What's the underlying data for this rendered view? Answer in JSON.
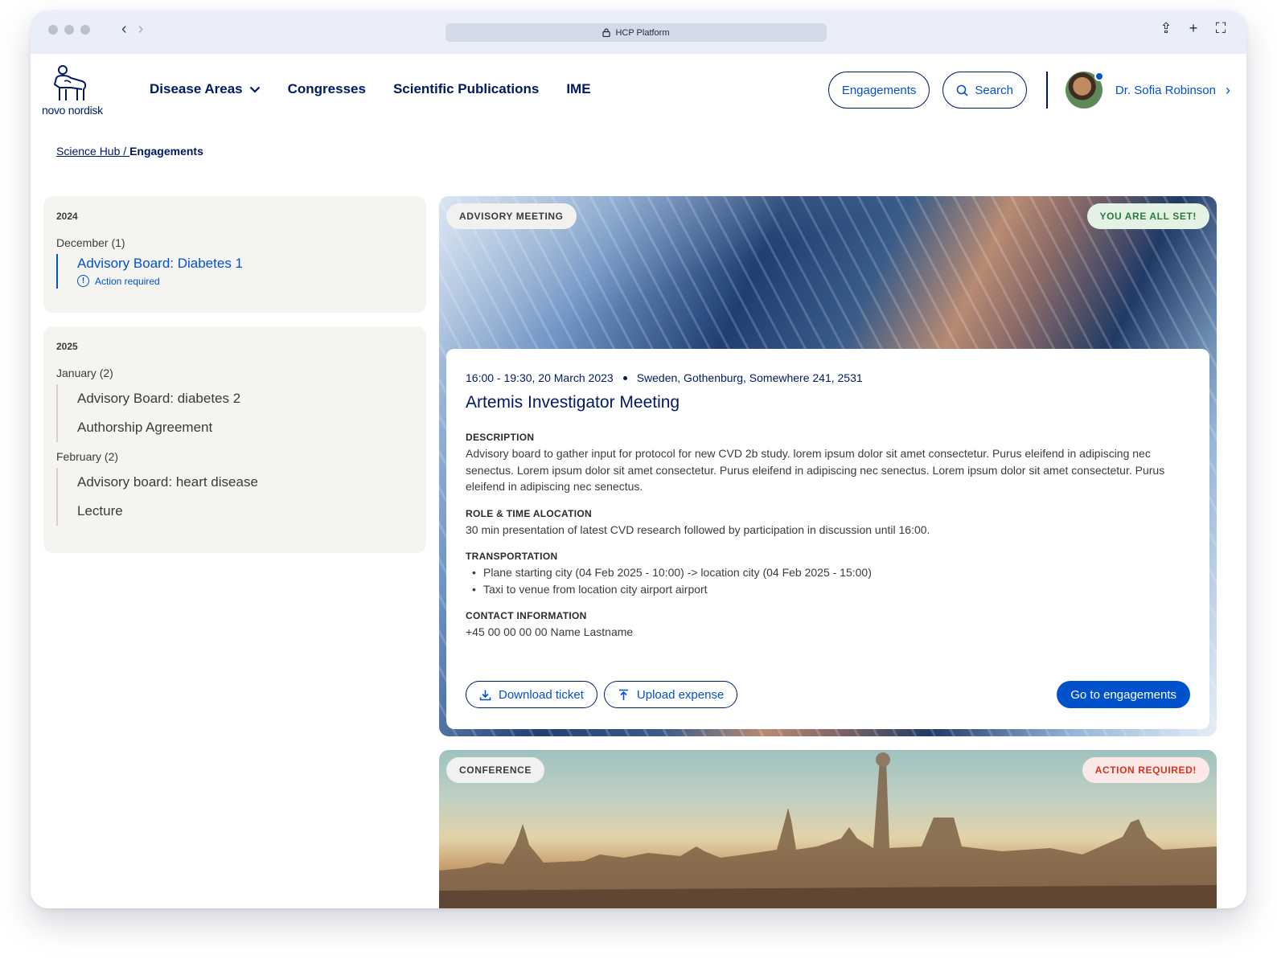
{
  "browser": {
    "url_label": "HCP Platform",
    "back_icon": "chevron-left-icon",
    "forward_icon": "chevron-right-icon"
  },
  "brand": {
    "logo_text": "novo nordisk"
  },
  "nav": {
    "items": [
      {
        "label": "Disease Areas",
        "has_dropdown": true
      },
      {
        "label": "Congresses"
      },
      {
        "label": "Scientific Publications"
      },
      {
        "label": "IME"
      }
    ],
    "engagements_label": "Engagements",
    "search_label": "Search",
    "user_name": "Dr. Sofia Robinson"
  },
  "breadcrumb": {
    "root": "Science Hub / ",
    "current": "Engagements"
  },
  "sidebar": {
    "years": [
      {
        "year": "2024",
        "months": [
          {
            "label": "December (1)",
            "entries": [
              {
                "title": "Advisory Board: Diabetes 1",
                "status": "Action required",
                "active": true
              }
            ]
          }
        ]
      },
      {
        "year": "2025",
        "months": [
          {
            "label": "January (2)",
            "entries": [
              {
                "title": "Advisory Board: diabetes 2"
              },
              {
                "title": "Authorship Agreement"
              }
            ]
          },
          {
            "label": "February (2)",
            "entries": [
              {
                "title": "Advisory board: heart disease"
              },
              {
                "title": "Lecture"
              }
            ]
          }
        ]
      }
    ]
  },
  "event": {
    "type_tag": "ADVISORY MEETING",
    "status_tag": "YOU ARE ALL SET!",
    "time": "16:00 - 19:30, 20 March 2023",
    "location": "Sweden, Gothenburg, Somewhere 241, 2531",
    "title": "Artemis Investigator Meeting",
    "description_label": "DESCRIPTION",
    "description": "Advisory board to gather input for protocol for new CVD 2b study. lorem ipsum dolor sit amet consectetur. Purus eleifend in adipiscing nec senectus. Lorem ipsum dolor sit amet consectetur. Purus eleifend in adipiscing nec senectus. Lorem ipsum dolor sit amet consectetur. Purus eleifend in adipiscing nec senectus.",
    "role_label": "ROLE & TIME ALOCATION",
    "role": "30 min presentation of latest CVD research followed by participation in discussion until 16:00.",
    "transport_label": "TRANSPORTATION",
    "transport": [
      "Plane starting city (04 Feb 2025 - 10:00) -> location city (04 Feb 2025 - 15:00)",
      "Taxi to venue from location city airport airport"
    ],
    "contact_label": "CONTACT INFORMATION",
    "contact": "+45 00 00 00 00  Name Lastname",
    "download_label": "Download ticket",
    "upload_label": "Upload expense",
    "goto_label": "Go to engagements"
  },
  "event2": {
    "type_tag": "CONFERENCE",
    "status_tag": "ACTION REQUIRED!"
  },
  "colors": {
    "primary": "#0052cc",
    "navy": "#001965",
    "success": "#2b7a3b",
    "danger": "#d2341f"
  }
}
